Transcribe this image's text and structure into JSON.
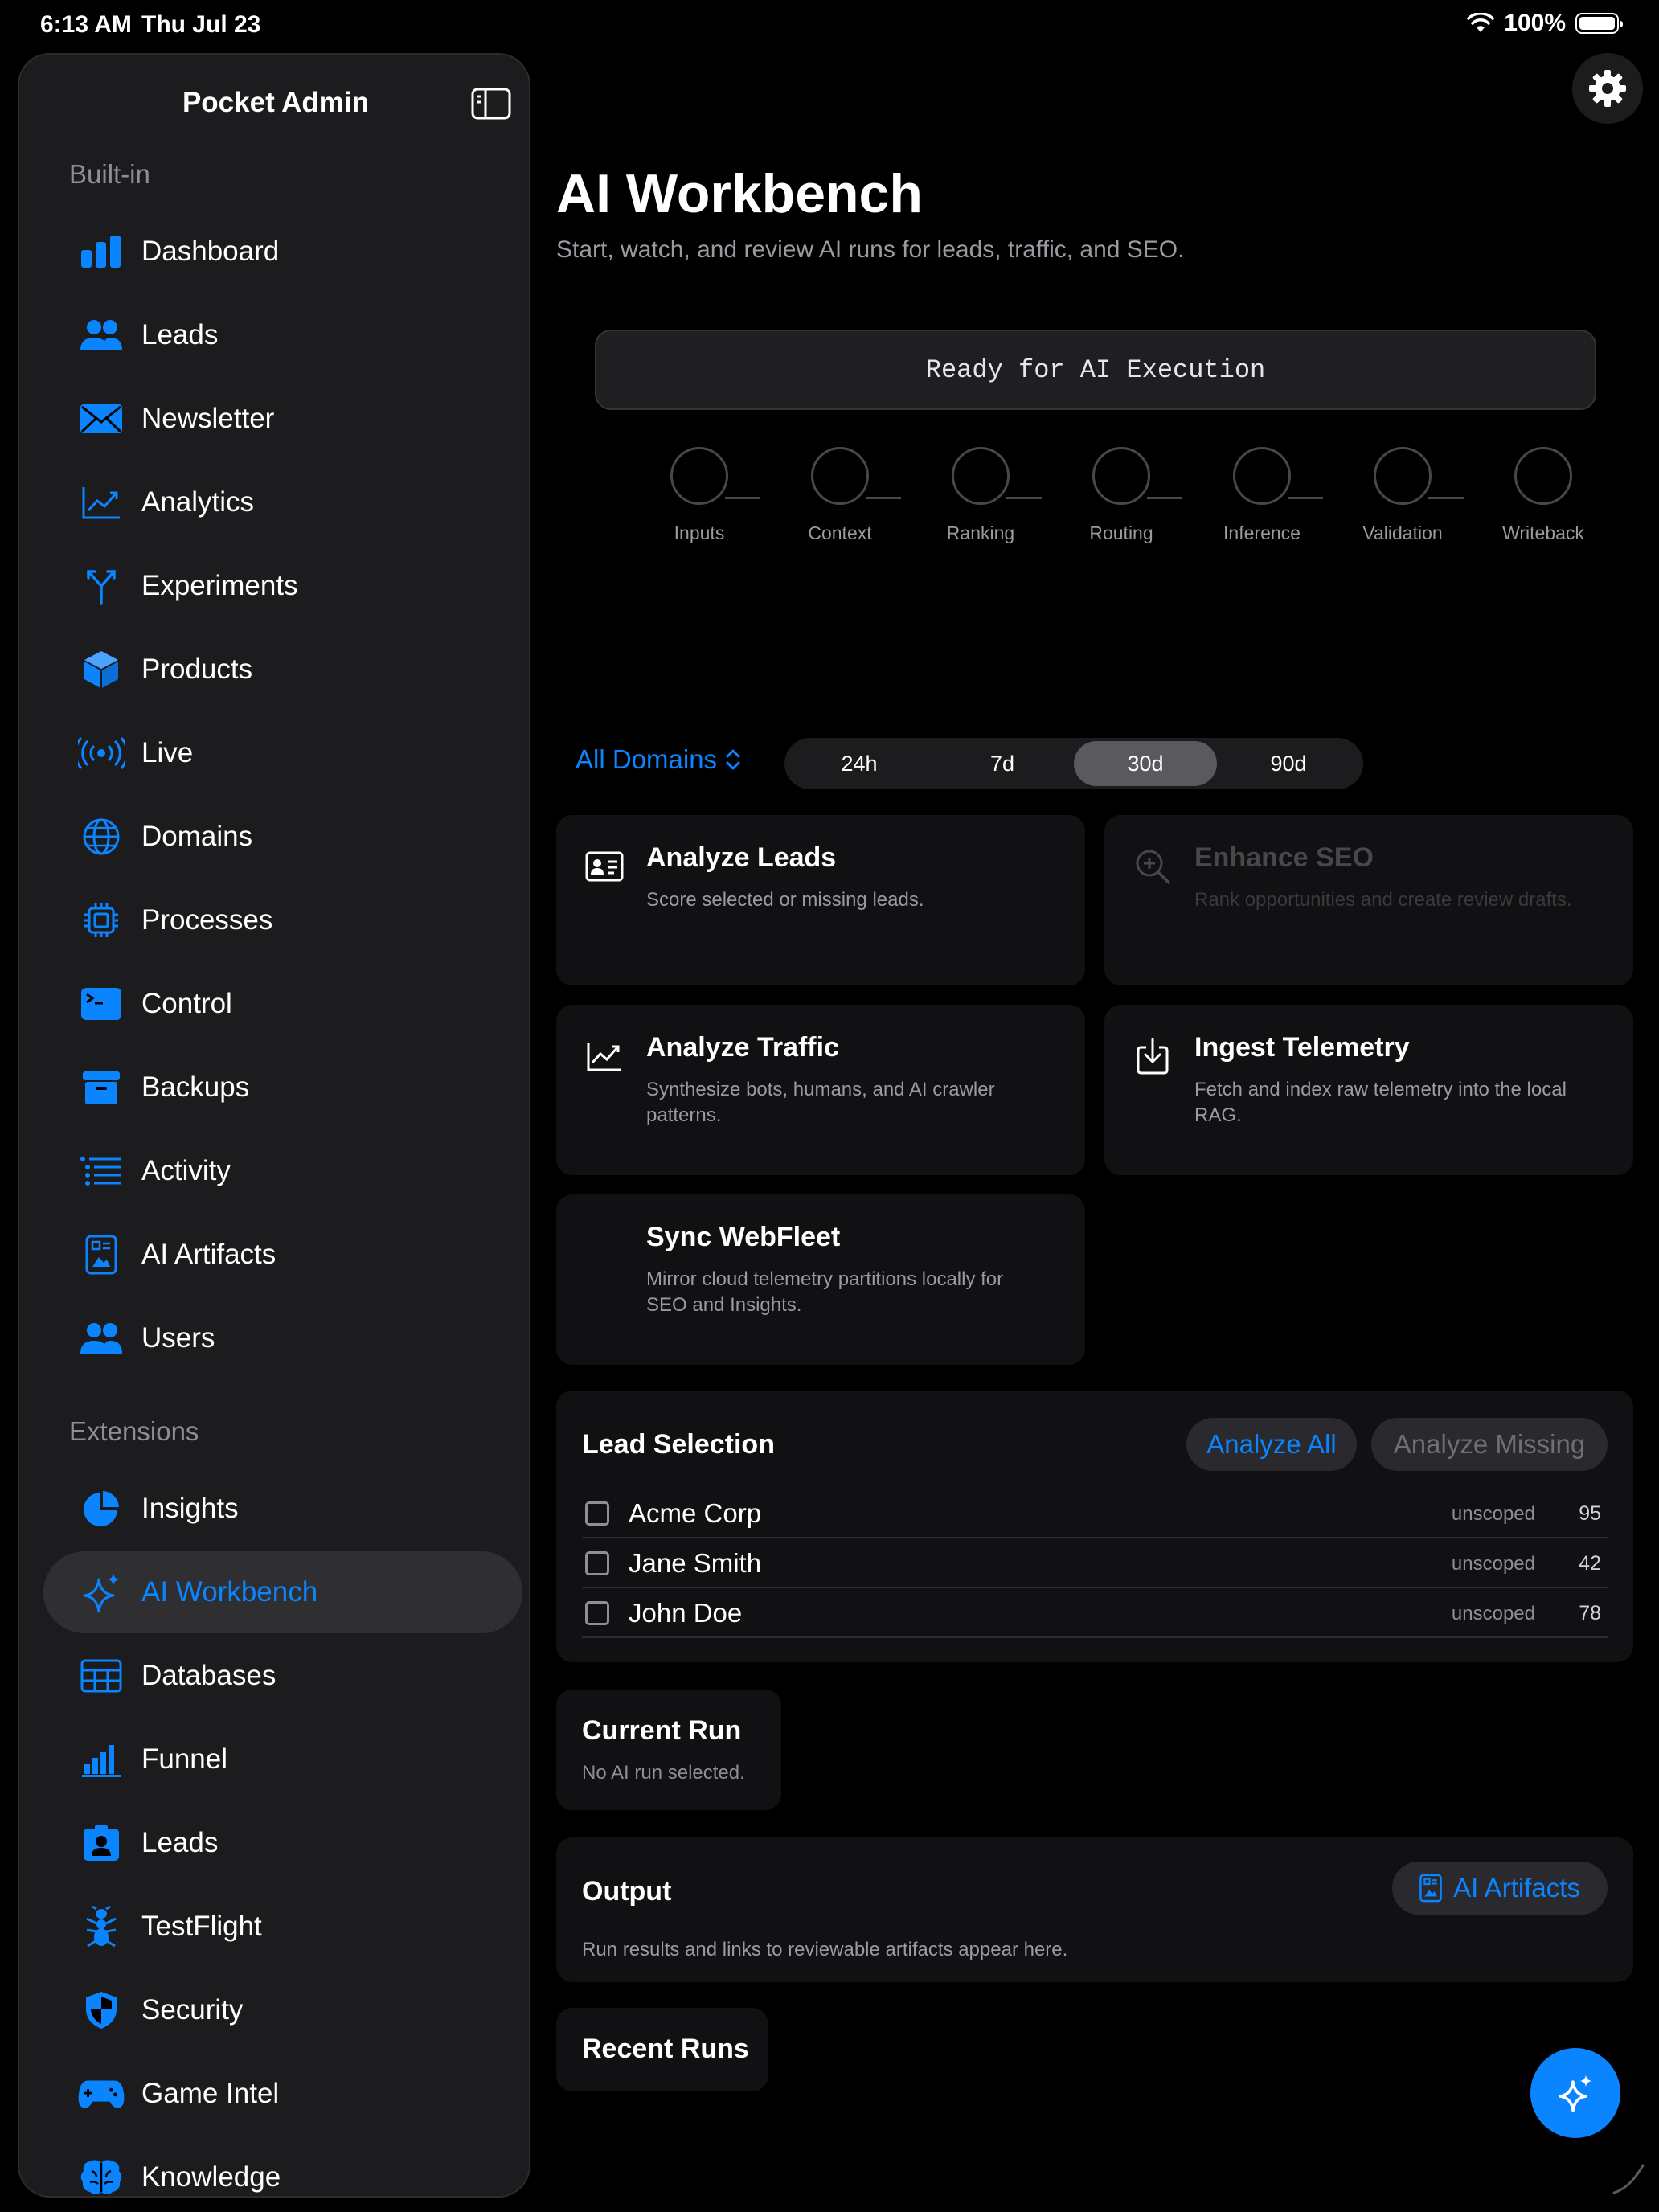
{
  "status_bar": {
    "time": "6:13 AM",
    "date": "Thu Jul 23",
    "battery": "100%"
  },
  "sidebar": {
    "title": "Pocket Admin",
    "builtin_label": "Built-in",
    "builtin_items": [
      {
        "label": "Dashboard",
        "icon": "chart-bar-icon"
      },
      {
        "label": "Leads",
        "icon": "people-icon"
      },
      {
        "label": "Newsletter",
        "icon": "envelope-icon"
      },
      {
        "label": "Analytics",
        "icon": "trend-line-icon"
      },
      {
        "label": "Experiments",
        "icon": "branch-icon"
      },
      {
        "label": "Products",
        "icon": "cube-icon"
      },
      {
        "label": "Live",
        "icon": "broadcast-icon"
      },
      {
        "label": "Domains",
        "icon": "globe-icon"
      },
      {
        "label": "Processes",
        "icon": "cpu-icon"
      },
      {
        "label": "Control",
        "icon": "terminal-icon"
      },
      {
        "label": "Backups",
        "icon": "archive-box-icon"
      },
      {
        "label": "Activity",
        "icon": "list-icon"
      },
      {
        "label": "AI Artifacts",
        "icon": "document-image-icon"
      },
      {
        "label": "Users",
        "icon": "people-icon"
      }
    ],
    "extensions_label": "Extensions",
    "extension_items": [
      {
        "label": "Insights",
        "icon": "pie-chart-icon"
      },
      {
        "label": "AI Workbench",
        "icon": "sparkles-icon",
        "active": true
      },
      {
        "label": "Databases",
        "icon": "table-icon"
      },
      {
        "label": "Funnel",
        "icon": "funnel-bars-icon"
      },
      {
        "label": "Leads",
        "icon": "contact-card-icon"
      },
      {
        "label": "TestFlight",
        "icon": "ant-icon"
      },
      {
        "label": "Security",
        "icon": "shield-icon"
      },
      {
        "label": "Game Intel",
        "icon": "gamecontroller-icon"
      },
      {
        "label": "Knowledge",
        "icon": "brain-icon"
      }
    ]
  },
  "main": {
    "title": "AI Workbench",
    "subtitle": "Start, watch, and review AI runs for leads, traffic, and SEO.",
    "status_text": "Ready for AI Execution",
    "pipeline": [
      "Inputs",
      "Context",
      "Ranking",
      "Routing",
      "Inference",
      "Validation",
      "Writeback"
    ],
    "domain_picker": "All Domains",
    "ranges": [
      "24h",
      "7d",
      "30d",
      "90d"
    ],
    "selected_range": "30d",
    "actions": [
      {
        "title": "Analyze Leads",
        "desc": "Score selected or missing leads.",
        "icon": "contact-card-icon",
        "enabled": true
      },
      {
        "title": "Enhance SEO",
        "desc": "Rank opportunities and create review drafts.",
        "icon": "magnifier-plus-icon",
        "enabled": false
      },
      {
        "title": "Analyze Traffic",
        "desc": "Synthesize bots, humans, and AI crawler patterns.",
        "icon": "trend-line-icon",
        "enabled": true
      },
      {
        "title": "Ingest Telemetry",
        "desc": "Fetch and index raw telemetry into the local RAG.",
        "icon": "tray-download-icon",
        "enabled": true
      },
      {
        "title": "Sync WebFleet",
        "desc": "Mirror cloud telemetry partitions locally for SEO and Insights.",
        "icon": "",
        "enabled": true
      }
    ],
    "lead_selection": {
      "title": "Lead Selection",
      "analyze_all": "Analyze All",
      "analyze_missing": "Analyze Missing",
      "leads": [
        {
          "name": "Acme Corp",
          "scope": "unscoped",
          "score": "95"
        },
        {
          "name": "Jane Smith",
          "scope": "unscoped",
          "score": "42"
        },
        {
          "name": "John Doe",
          "scope": "unscoped",
          "score": "78"
        }
      ]
    },
    "current_run": {
      "title": "Current Run",
      "text": "No AI run selected."
    },
    "output": {
      "title": "Output",
      "button": "AI Artifacts",
      "text": "Run results and links to reviewable artifacts appear here."
    },
    "recent_runs": {
      "title": "Recent Runs"
    }
  },
  "colors": {
    "accent": "#0a84ff",
    "background": "#000000",
    "sidebar": "#1c1c1e",
    "card": "#111113"
  }
}
